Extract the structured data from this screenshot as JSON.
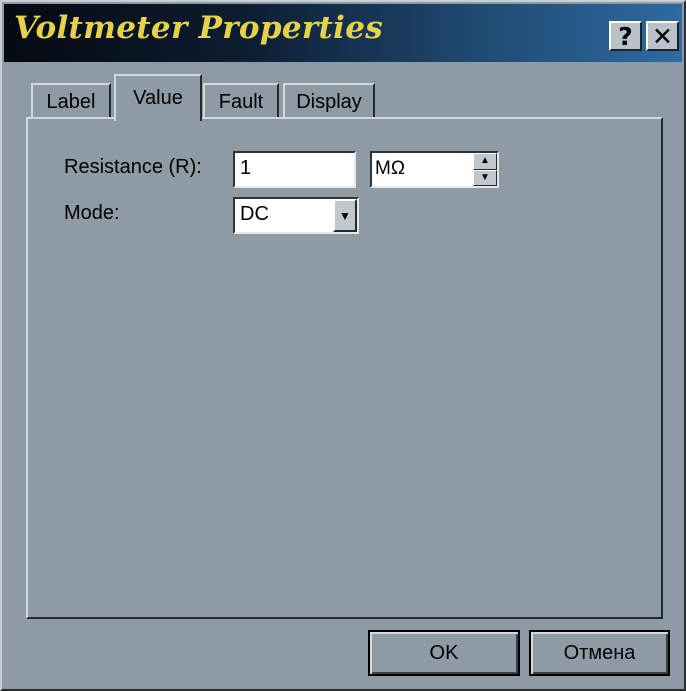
{
  "window": {
    "title": "Voltmeter Properties",
    "help_label": "?",
    "close_label": "✕"
  },
  "tabs": [
    {
      "label": "Label",
      "selected": false
    },
    {
      "label": "Value",
      "selected": true
    },
    {
      "label": "Fault",
      "selected": false
    },
    {
      "label": "Display",
      "selected": false
    }
  ],
  "fields": {
    "resistance": {
      "label": "Resistance (R):",
      "value": "1",
      "unit": "MΩ"
    },
    "mode": {
      "label": "Mode:",
      "value": "DC"
    }
  },
  "buttons": {
    "ok": "OK",
    "cancel": "Отмена"
  },
  "colors": {
    "dialog_bg": "#8e9aa4",
    "title_text": "#e6d24a",
    "titlebar_dark": "#050a12",
    "titlebar_light": "#2f6aa0"
  },
  "icons": {
    "spin_up": "▲",
    "spin_down": "▼",
    "dropdown": "▼"
  }
}
